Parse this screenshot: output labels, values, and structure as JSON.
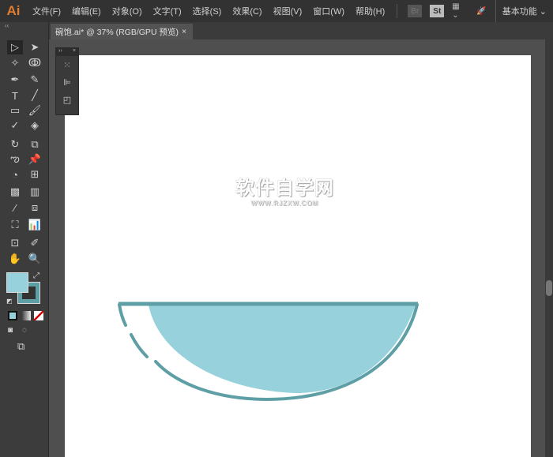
{
  "app": {
    "logo": "Ai",
    "workspace": "基本功能"
  },
  "menu": [
    "文件(F)",
    "编辑(E)",
    "对象(O)",
    "文字(T)",
    "选择(S)",
    "效果(C)",
    "视图(V)",
    "窗口(W)",
    "帮助(H)"
  ],
  "menu_icons": {
    "br": "Br",
    "st": "St"
  },
  "document_tab": {
    "title": "碗饱.ai* @ 37% (RGB/GPU 预览)",
    "close": "×"
  },
  "watermark": {
    "main": "软件自学网",
    "url": "WWW.RJZXW.COM"
  },
  "colors": {
    "fill": "#96d1dc",
    "stroke": "#5e9ea5",
    "background": "#535353"
  }
}
